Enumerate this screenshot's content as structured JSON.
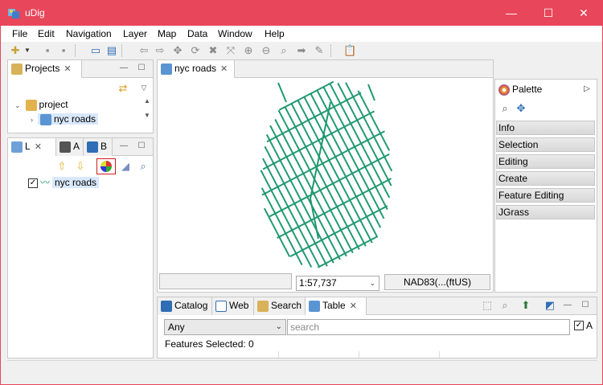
{
  "window": {
    "title": "uDig",
    "controls": [
      "—",
      "☐",
      "✕"
    ]
  },
  "menu": [
    "File",
    "Edit",
    "Navigation",
    "Layer",
    "Map",
    "Data",
    "Window",
    "Help"
  ],
  "projects": {
    "tab_label": "Projects",
    "root": "project",
    "child": "nyc roads"
  },
  "layers": {
    "tab_labels": [
      "L",
      "A",
      "B"
    ],
    "layer_name": "nyc roads"
  },
  "map": {
    "tab_label": "nyc roads",
    "scale": "1:57,737",
    "crs": "NAD83(...(ftUS)"
  },
  "palette": {
    "title": "Palette",
    "categories": [
      "Info",
      "Selection",
      "Editing",
      "Create",
      "Feature Editing",
      "JGrass"
    ]
  },
  "bottom": {
    "tabs": [
      "Catalog",
      "Web",
      "Search",
      "Table"
    ],
    "filter_value": "Any",
    "search_placeholder": "search",
    "checkbox_label": "A",
    "features_selected": "Features Selected: 0"
  },
  "colors": {
    "title_bar": "#e8465a",
    "roads": "#1f9870",
    "selection_bg": "#d9e8fb"
  }
}
